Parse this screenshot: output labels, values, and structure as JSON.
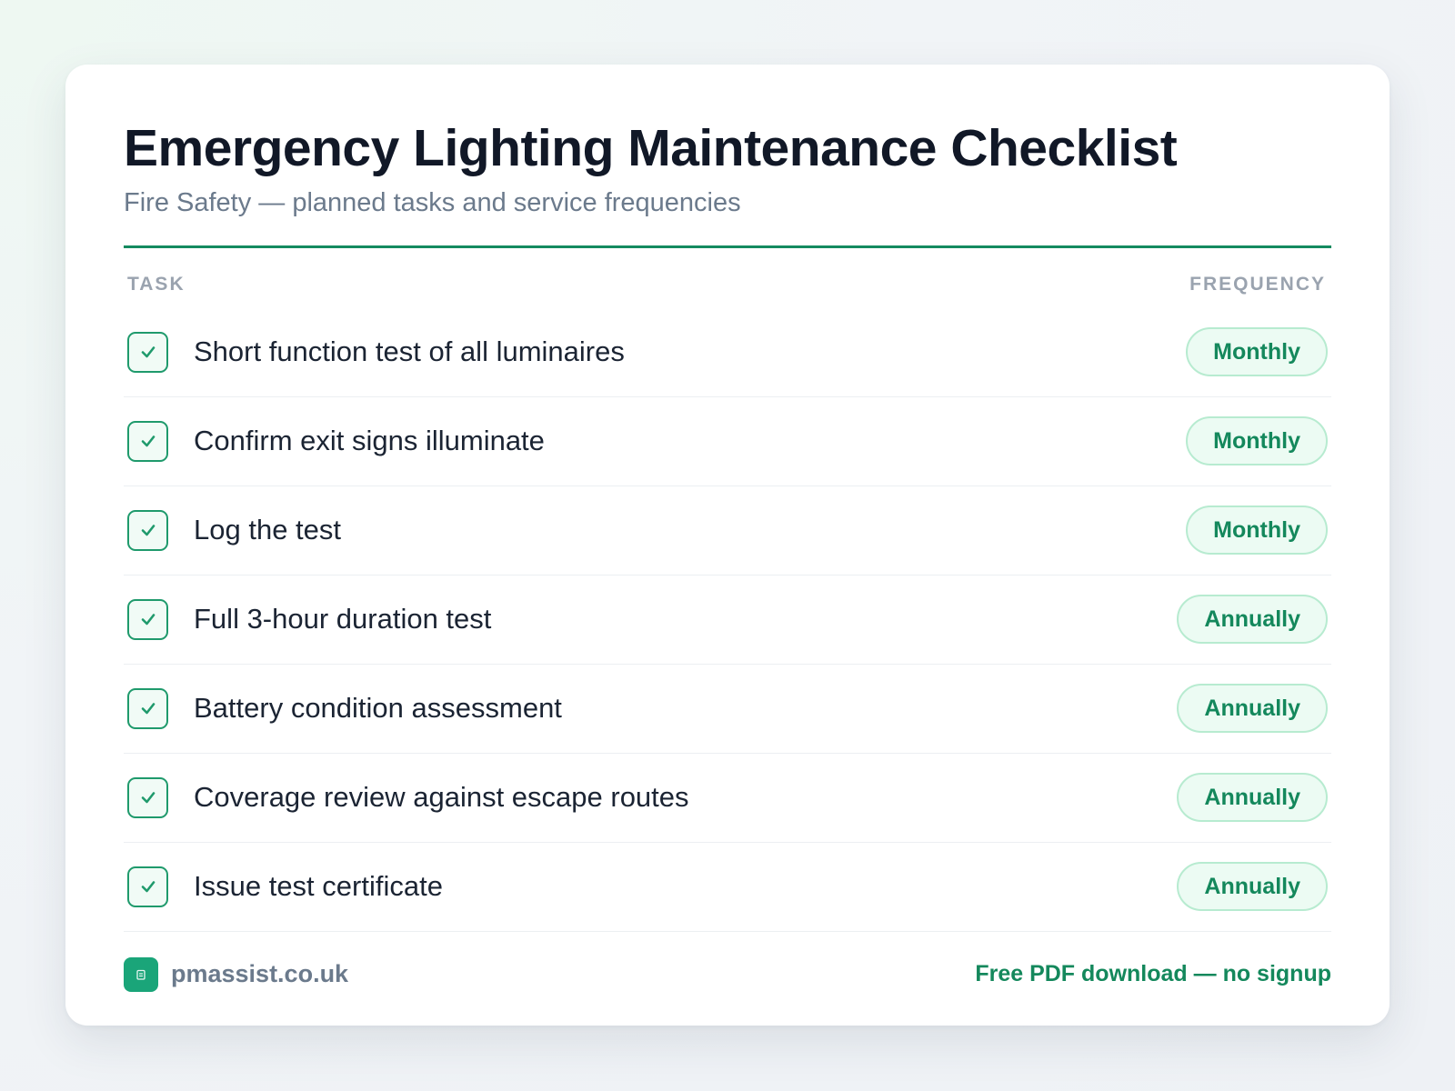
{
  "header": {
    "title": "Emergency Lighting Maintenance Checklist",
    "subtitle": "Fire Safety — planned tasks and service frequencies"
  },
  "columns": {
    "task": "TASK",
    "frequency": "FREQUENCY"
  },
  "tasks": [
    {
      "label": "Short function test of all luminaires",
      "frequency": "Monthly",
      "checked": true
    },
    {
      "label": "Confirm exit signs illuminate",
      "frequency": "Monthly",
      "checked": true
    },
    {
      "label": "Log the test",
      "frequency": "Monthly",
      "checked": true
    },
    {
      "label": "Full 3-hour duration test",
      "frequency": "Annually",
      "checked": true
    },
    {
      "label": "Battery condition assessment",
      "frequency": "Annually",
      "checked": true
    },
    {
      "label": "Coverage review against escape routes",
      "frequency": "Annually",
      "checked": true
    },
    {
      "label": "Issue test certificate",
      "frequency": "Annually",
      "checked": true
    }
  ],
  "footer": {
    "brand": "pmassist.co.uk",
    "cta": "Free PDF download — no signup"
  },
  "colors": {
    "accent": "#148a5f",
    "badge_bg": "#ecfbf3",
    "badge_border": "#b7ebd0",
    "logo": "#1aa579"
  },
  "icons": {
    "checkbox": "check-icon",
    "brand": "logo-icon"
  }
}
